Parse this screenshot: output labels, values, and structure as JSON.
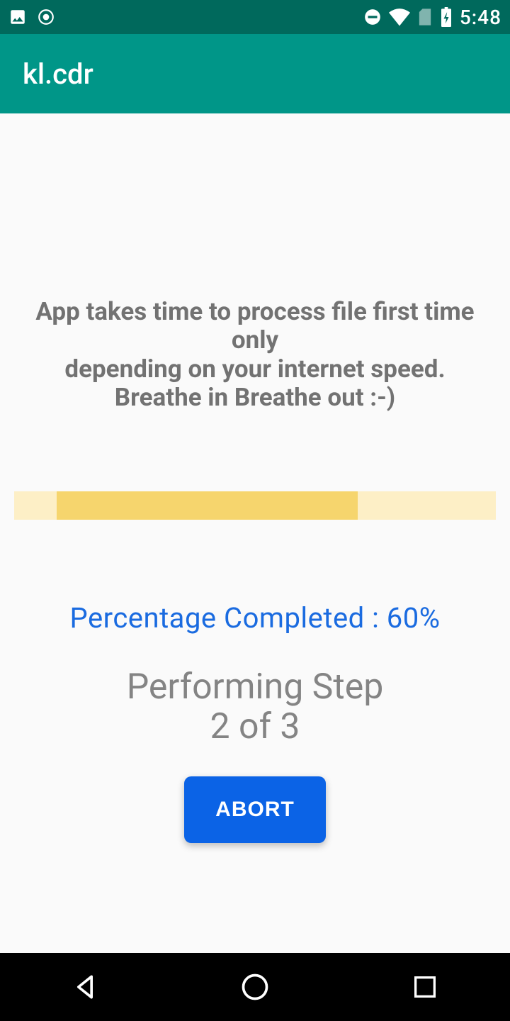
{
  "status_bar": {
    "time": "5:48"
  },
  "app_bar": {
    "title": "kl.cdr"
  },
  "main": {
    "info_line1": "App takes time to process file first time only",
    "info_line2": "depending on your internet speed.",
    "info_line3": "Breathe in Breathe out :-)",
    "percentage_label": "Percentage Completed : 60%",
    "step_line1": "Performing Step",
    "step_line2": "2 of 3",
    "abort_label": "ABORT",
    "progress_percent": 60,
    "current_step": 2,
    "total_steps": 3
  }
}
